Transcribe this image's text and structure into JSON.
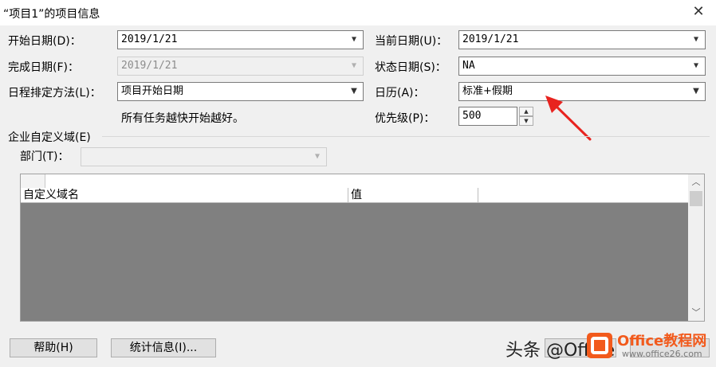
{
  "window": {
    "title": "“项目1”的项目信息",
    "close_glyph": "✕"
  },
  "fields": {
    "start_date": {
      "label": "开始日期(D)：",
      "value": "2019/1/21"
    },
    "finish_date": {
      "label": "完成日期(F)：",
      "value": "2019/1/21"
    },
    "schedule_from": {
      "label": "日程排定方法(L)：",
      "value": "项目开始日期"
    },
    "schedule_note": "所有任务越快开始越好。",
    "current_date": {
      "label": "当前日期(U)：",
      "value": "2019/1/21"
    },
    "status_date": {
      "label": "状态日期(S)：",
      "value": "NA"
    },
    "calendar": {
      "label": "日历(A)：",
      "value": "标准+假期"
    },
    "priority": {
      "label": "优先级(P)：",
      "value": "500"
    }
  },
  "enterprise": {
    "group_label": "企业自定义域(E)",
    "department_label": "部门(T)：",
    "department_value": "",
    "table": {
      "columns": [
        "自定义域名",
        "值"
      ]
    }
  },
  "buttons": {
    "help": "帮助(H)",
    "statistics": "统计信息(I)..."
  },
  "watermark": {
    "text": "头条 @Office",
    "brand": "Office教程网",
    "site": "www.office26.com"
  },
  "icons": {
    "dropdown": "chevron-down-icon",
    "spin_up": "spin-up-icon",
    "spin_down": "spin-down-icon",
    "scroll_up": "scroll-up-icon",
    "scroll_down": "scroll-down-icon"
  },
  "colors": {
    "annotation_arrow": "#e8231f",
    "grid_body": "#808080",
    "brand_orange": "#f25a1c"
  }
}
